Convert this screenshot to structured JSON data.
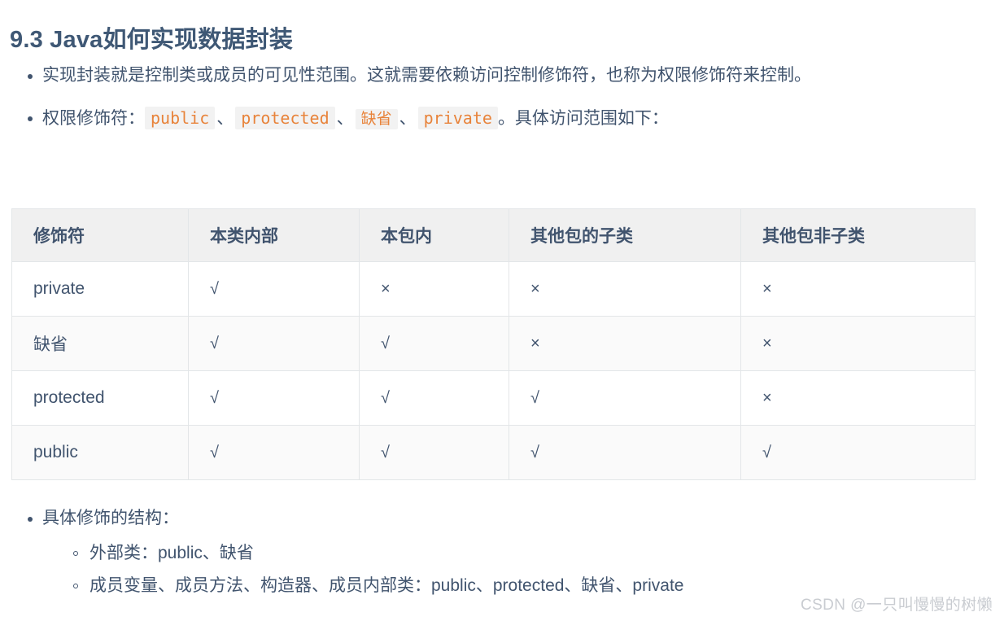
{
  "title": "9.3 Java如何实现数据封装",
  "intro": {
    "bullet1": "实现封装就是控制类或成员的可见性范围。这就需要依赖访问控制修饰符，也称为权限修饰符来控制。",
    "bullet2": {
      "prefix": "权限修饰符：",
      "codes": [
        "public",
        "protected",
        "缺省",
        "private"
      ],
      "separator": "、",
      "suffix": "。具体访问范围如下："
    }
  },
  "table": {
    "headers": [
      "修饰符",
      "本类内部",
      "本包内",
      "其他包的子类",
      "其他包非子类"
    ],
    "rows": [
      {
        "modifier": "private",
        "cells": [
          "√",
          "×",
          "×",
          "×"
        ]
      },
      {
        "modifier": "缺省",
        "cells": [
          "√",
          "√",
          "×",
          "×"
        ]
      },
      {
        "modifier": "protected",
        "cells": [
          "√",
          "√",
          "√",
          "×"
        ]
      },
      {
        "modifier": "public",
        "cells": [
          "√",
          "√",
          "√",
          "√"
        ]
      }
    ]
  },
  "outro": {
    "bullet": "具体修饰的结构：",
    "sub_items": [
      "外部类：public、缺省",
      "成员变量、成员方法、构造器、成员内部类：public、protected、缺省、private"
    ]
  },
  "watermark": "CSDN @一只叫慢慢的树懒",
  "colors": {
    "heading": "#3f5875",
    "body_text": "#41546e",
    "code_text": "#e8833a",
    "code_bg": "#f2f2f2",
    "table_header_bg": "#f0f0f0",
    "table_border": "#e3e6e8",
    "row_alt_bg": "#fafafa",
    "watermark": "#c9ccd1"
  }
}
